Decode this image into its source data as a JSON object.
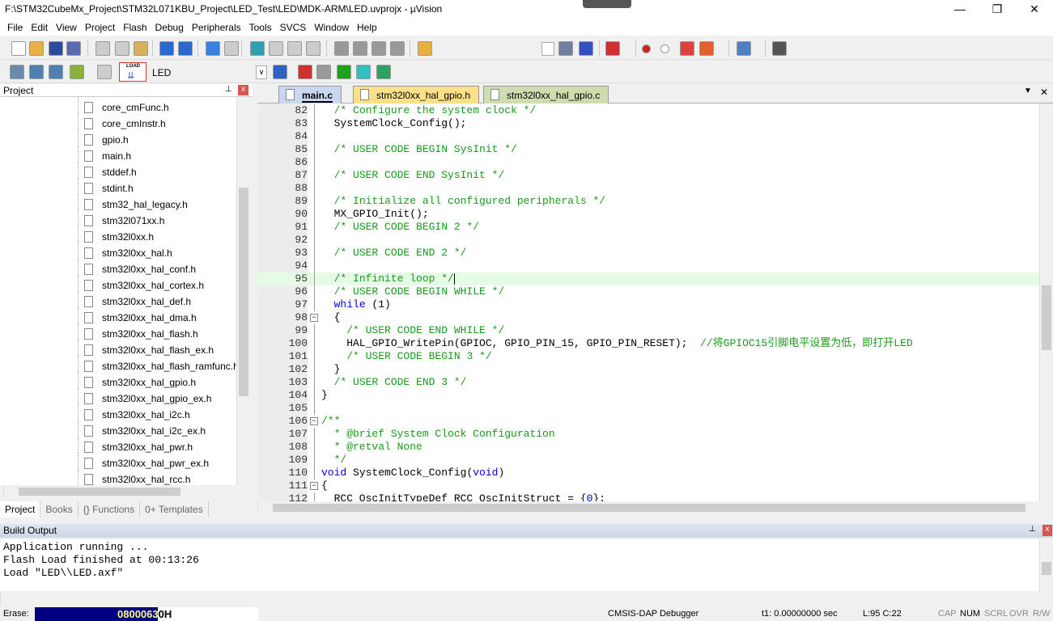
{
  "window": {
    "title": "F:\\STM32CubeMx_Project\\STM32L071KBU_Project\\LED_Test\\LED\\MDK-ARM\\LED.uvprojx - µVision",
    "minimize": "—",
    "maximize": "❐",
    "close": "✕"
  },
  "menu": [
    "File",
    "Edit",
    "View",
    "Project",
    "Flash",
    "Debug",
    "Peripherals",
    "Tools",
    "SVCS",
    "Window",
    "Help"
  ],
  "toolbar2": {
    "target": "LED",
    "load_label": "LOAD"
  },
  "project_pane": {
    "title": "Project",
    "pin": "⊥",
    "close": "x",
    "files": [
      "core_cmFunc.h",
      "core_cmInstr.h",
      "gpio.h",
      "main.h",
      "stddef.h",
      "stdint.h",
      "stm32_hal_legacy.h",
      "stm32l071xx.h",
      "stm32l0xx.h",
      "stm32l0xx_hal.h",
      "stm32l0xx_hal_conf.h",
      "stm32l0xx_hal_cortex.h",
      "stm32l0xx_hal_def.h",
      "stm32l0xx_hal_dma.h",
      "stm32l0xx_hal_flash.h",
      "stm32l0xx_hal_flash_ex.h",
      "stm32l0xx_hal_flash_ramfunc.h",
      "stm32l0xx_hal_gpio.h",
      "stm32l0xx_hal_gpio_ex.h",
      "stm32l0xx_hal_i2c.h",
      "stm32l0xx_hal_i2c_ex.h",
      "stm32l0xx_hal_pwr.h",
      "stm32l0xx_hal_pwr_ex.h",
      "stm32l0xx_hal_rcc.h"
    ],
    "tabs": [
      "Project",
      "Books",
      "{} Functions",
      "0+ Templates"
    ]
  },
  "editor": {
    "tabs": [
      {
        "label": "main.c",
        "color": "#c9d8f0"
      },
      {
        "label": "stm32l0xx_hal_gpio.h",
        "color": "#fbe08a"
      },
      {
        "label": "stm32l0xx_hal_gpio.c",
        "color": "#cfdcb0"
      }
    ],
    "highlight_line": 95,
    "lines": [
      {
        "n": "82",
        "s": [
          [
            "  ",
            "nm"
          ],
          [
            "/* Configure the system clock */",
            "cm"
          ]
        ]
      },
      {
        "n": "83",
        "s": [
          [
            "  SystemClock_Config();",
            "nm"
          ]
        ]
      },
      {
        "n": "84",
        "s": []
      },
      {
        "n": "85",
        "s": [
          [
            "  ",
            "nm"
          ],
          [
            "/* USER CODE BEGIN SysInit */",
            "cm"
          ]
        ]
      },
      {
        "n": "86",
        "s": []
      },
      {
        "n": "87",
        "s": [
          [
            "  ",
            "nm"
          ],
          [
            "/* USER CODE END SysInit */",
            "cm"
          ]
        ]
      },
      {
        "n": "88",
        "s": []
      },
      {
        "n": "89",
        "s": [
          [
            "  ",
            "nm"
          ],
          [
            "/* Initialize all configured peripherals */",
            "cm"
          ]
        ]
      },
      {
        "n": "90",
        "s": [
          [
            "  MX_GPIO_Init();",
            "nm"
          ]
        ]
      },
      {
        "n": "91",
        "s": [
          [
            "  ",
            "nm"
          ],
          [
            "/* USER CODE BEGIN 2 */",
            "cm"
          ]
        ]
      },
      {
        "n": "92",
        "s": []
      },
      {
        "n": "93",
        "s": [
          [
            "  ",
            "nm"
          ],
          [
            "/* USER CODE END 2 */",
            "cm"
          ]
        ]
      },
      {
        "n": "94",
        "s": []
      },
      {
        "n": "95",
        "s": [
          [
            "  ",
            "nm"
          ],
          [
            "/* Infinite loop */",
            "cm"
          ]
        ]
      },
      {
        "n": "96",
        "s": [
          [
            "  ",
            "nm"
          ],
          [
            "/* USER CODE BEGIN WHILE */",
            "cm"
          ]
        ]
      },
      {
        "n": "97",
        "s": [
          [
            "  ",
            "nm"
          ],
          [
            "while",
            "kw"
          ],
          [
            " (1)",
            "nm"
          ]
        ]
      },
      {
        "n": "98",
        "fold": "−",
        "s": [
          [
            "  {",
            "nm"
          ]
        ]
      },
      {
        "n": "99",
        "s": [
          [
            "    ",
            "nm"
          ],
          [
            "/* USER CODE END WHILE */",
            "cm"
          ]
        ]
      },
      {
        "n": "100",
        "s": [
          [
            "    HAL_GPIO_WritePin(GPIOC, GPIO_PIN_15, GPIO_PIN_RESET);  ",
            "nm"
          ],
          [
            "//将GPIOC15引脚电平设置为低，即打开LED",
            "cm"
          ]
        ]
      },
      {
        "n": "101",
        "s": [
          [
            "    ",
            "nm"
          ],
          [
            "/* USER CODE BEGIN 3 */",
            "cm"
          ]
        ]
      },
      {
        "n": "102",
        "s": [
          [
            "  }",
            "nm"
          ]
        ]
      },
      {
        "n": "103",
        "s": [
          [
            "  ",
            "nm"
          ],
          [
            "/* USER CODE END 3 */",
            "cm"
          ]
        ]
      },
      {
        "n": "104",
        "s": [
          [
            "}",
            "nm"
          ]
        ]
      },
      {
        "n": "105",
        "s": []
      },
      {
        "n": "106",
        "fold": "−",
        "s": [
          [
            "/**",
            "cm"
          ]
        ]
      },
      {
        "n": "107",
        "s": [
          [
            "  * @brief System Clock Configuration",
            "cm"
          ]
        ]
      },
      {
        "n": "108",
        "s": [
          [
            "  * @retval None",
            "cm"
          ]
        ]
      },
      {
        "n": "109",
        "s": [
          [
            "  */",
            "cm"
          ]
        ]
      },
      {
        "n": "110",
        "s": [
          [
            "void",
            "kw"
          ],
          [
            " SystemClock_Config(",
            "nm"
          ],
          [
            "void",
            "kw"
          ],
          [
            ")",
            "nm"
          ]
        ]
      },
      {
        "n": "111",
        "fold": "−",
        "s": [
          [
            "{",
            "nm"
          ]
        ]
      },
      {
        "n": "112",
        "s": [
          [
            "  RCC_OscInitTypeDef RCC_OscInitStruct = {",
            "nm"
          ],
          [
            "0",
            "kw"
          ],
          [
            "};",
            "nm"
          ]
        ]
      }
    ]
  },
  "build_output": {
    "title": "Build Output",
    "lines": [
      "Application running ...",
      "Flash Load finished at 00:13:26",
      "Load \"LED\\\\LED.axf\""
    ]
  },
  "status": {
    "erase_label": "Erase:",
    "address": "08000630H",
    "progress": 0.55,
    "debugger": "CMSIS-DAP Debugger",
    "time": "t1: 0.00000000 sec",
    "position": "L:95 C:22",
    "cap": "CAP",
    "num": "NUM",
    "scrl": "SCRL",
    "ovr": "OVR",
    "rw": "R/W"
  }
}
